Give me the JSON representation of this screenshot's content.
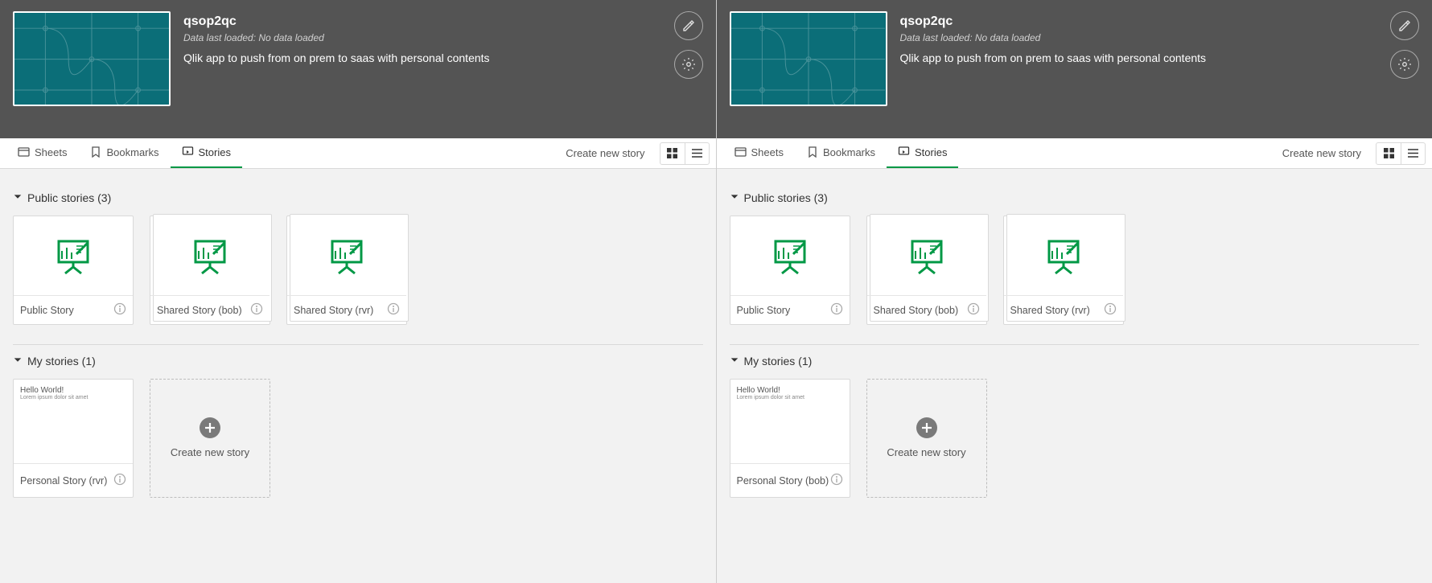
{
  "panes": [
    {
      "app": {
        "title": "qsop2qc",
        "status": "Data last loaded: No data loaded",
        "description": "Qlik app to push from on prem to saas with personal contents"
      },
      "tabs": {
        "sheets": "Sheets",
        "bookmarks": "Bookmarks",
        "stories": "Stories"
      },
      "createStory": "Create new story",
      "sections": {
        "public": {
          "title": "Public stories (3)",
          "items": [
            {
              "label": "Public Story"
            },
            {
              "label": "Shared Story (bob)"
            },
            {
              "label": "Shared Story (rvr)"
            }
          ]
        },
        "mine": {
          "title": "My stories (1)",
          "preview": "Hello World!",
          "items": [
            {
              "label": "Personal Story (rvr)"
            }
          ],
          "addLabel": "Create new story"
        }
      }
    },
    {
      "app": {
        "title": "qsop2qc",
        "status": "Data last loaded: No data loaded",
        "description": "Qlik app to push from on prem to saas with personal contents"
      },
      "tabs": {
        "sheets": "Sheets",
        "bookmarks": "Bookmarks",
        "stories": "Stories"
      },
      "createStory": "Create new story",
      "sections": {
        "public": {
          "title": "Public stories (3)",
          "items": [
            {
              "label": "Public Story"
            },
            {
              "label": "Shared Story (bob)"
            },
            {
              "label": "Shared Story (rvr)"
            }
          ]
        },
        "mine": {
          "title": "My stories (1)",
          "preview": "Hello World!",
          "items": [
            {
              "label": "Personal Story (bob)"
            }
          ],
          "addLabel": "Create new story"
        }
      }
    }
  ]
}
